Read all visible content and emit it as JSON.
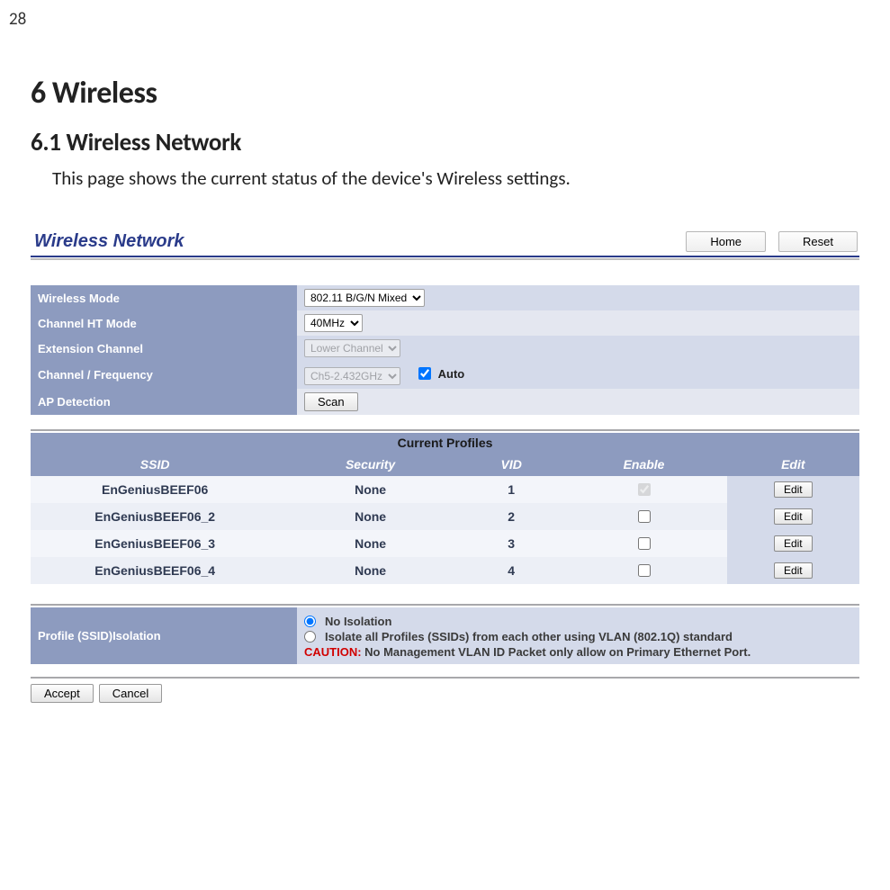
{
  "doc": {
    "page_number": "28",
    "h1": "6  Wireless",
    "h2": "6.1   Wireless Network",
    "intro": "This page shows the current status of the device's Wireless settings."
  },
  "ui": {
    "title": "Wireless Network",
    "buttons": {
      "home": "Home",
      "reset": "Reset",
      "accept": "Accept",
      "cancel": "Cancel",
      "scan": "Scan",
      "edit": "Edit"
    },
    "form": {
      "wireless_mode": {
        "label": "Wireless Mode",
        "value": "802.11 B/G/N Mixed"
      },
      "channel_ht_mode": {
        "label": "Channel HT Mode",
        "value": "40MHz"
      },
      "extension_channel": {
        "label": "Extension Channel",
        "value": "Lower Channel"
      },
      "channel_freq": {
        "label": "Channel / Frequency",
        "value": "Ch5-2.432GHz",
        "auto_label": "Auto",
        "auto_checked": true
      },
      "ap_detection": {
        "label": "AP Detection"
      }
    },
    "profiles": {
      "heading": "Current Profiles",
      "columns": {
        "ssid": "SSID",
        "security": "Security",
        "vid": "VID",
        "enable": "Enable",
        "edit": "Edit"
      },
      "rows": [
        {
          "ssid": "EnGeniusBEEF06",
          "security": "None",
          "vid": "1",
          "enabled": true
        },
        {
          "ssid": "EnGeniusBEEF06_2",
          "security": "None",
          "vid": "2",
          "enabled": false
        },
        {
          "ssid": "EnGeniusBEEF06_3",
          "security": "None",
          "vid": "3",
          "enabled": false
        },
        {
          "ssid": "EnGeniusBEEF06_4",
          "security": "None",
          "vid": "4",
          "enabled": false
        }
      ]
    },
    "isolation": {
      "label": "Profile (SSID)Isolation",
      "opt_no": "No Isolation",
      "opt_iso": "Isolate all Profiles (SSIDs) from each other using VLAN (802.1Q) standard",
      "caution_label": "CAUTION:",
      "caution_text": " No Management VLAN ID Packet only allow on Primary Ethernet Port."
    }
  }
}
